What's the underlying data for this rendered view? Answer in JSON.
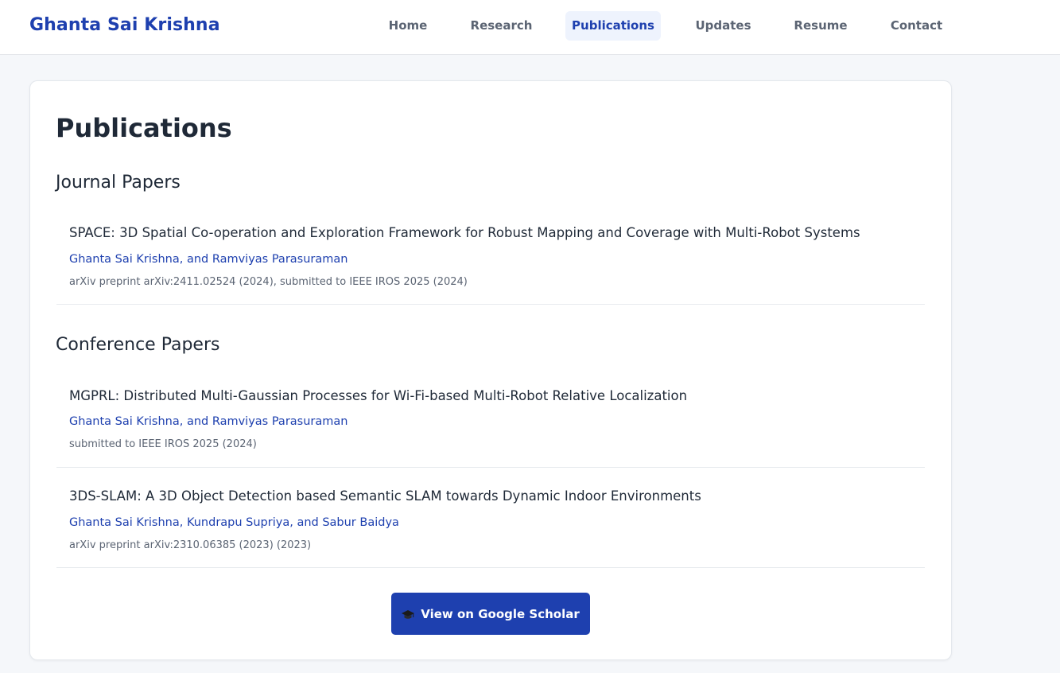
{
  "header": {
    "brand": "Ghanta Sai Krishna",
    "nav": [
      {
        "label": "Home",
        "active": false
      },
      {
        "label": "Research",
        "active": false
      },
      {
        "label": "Publications",
        "active": true
      },
      {
        "label": "Updates",
        "active": false
      },
      {
        "label": "Resume",
        "active": false
      },
      {
        "label": "Contact",
        "active": false
      }
    ]
  },
  "main": {
    "title": "Publications",
    "sections": [
      {
        "title": "Journal Papers",
        "papers": [
          {
            "title": "SPACE: 3D Spatial Co-operation and Exploration Framework for Robust Mapping and Coverage with Multi-Robot Systems",
            "authors": "Ghanta Sai Krishna, and Ramviyas Parasuraman",
            "venue": "arXiv preprint arXiv:2411.02524 (2024), submitted to IEEE IROS 2025 (2024)"
          }
        ]
      },
      {
        "title": "Conference Papers",
        "papers": [
          {
            "title": "MGPRL: Distributed Multi-Gaussian Processes for Wi-Fi-based Multi-Robot Relative Localization",
            "authors": "Ghanta Sai Krishna, and Ramviyas Parasuraman",
            "venue": "submitted to IEEE IROS 2025 (2024)"
          },
          {
            "title": "3DS-SLAM: A 3D Object Detection based Semantic SLAM towards Dynamic Indoor Environments",
            "authors": "Ghanta Sai Krishna, Kundrapu Supriya, and Sabur Baidya",
            "venue": "arXiv preprint arXiv:2310.06385 (2023) (2023)"
          }
        ]
      }
    ],
    "scholar_button": {
      "label": "View on Google Scholar",
      "icon": "graduation-cap-icon"
    }
  },
  "colors": {
    "accent": "#1e40af",
    "nav_active_bg": "#eef3fd",
    "page_bg": "#f5f7fa",
    "muted_text": "#5b6473"
  }
}
